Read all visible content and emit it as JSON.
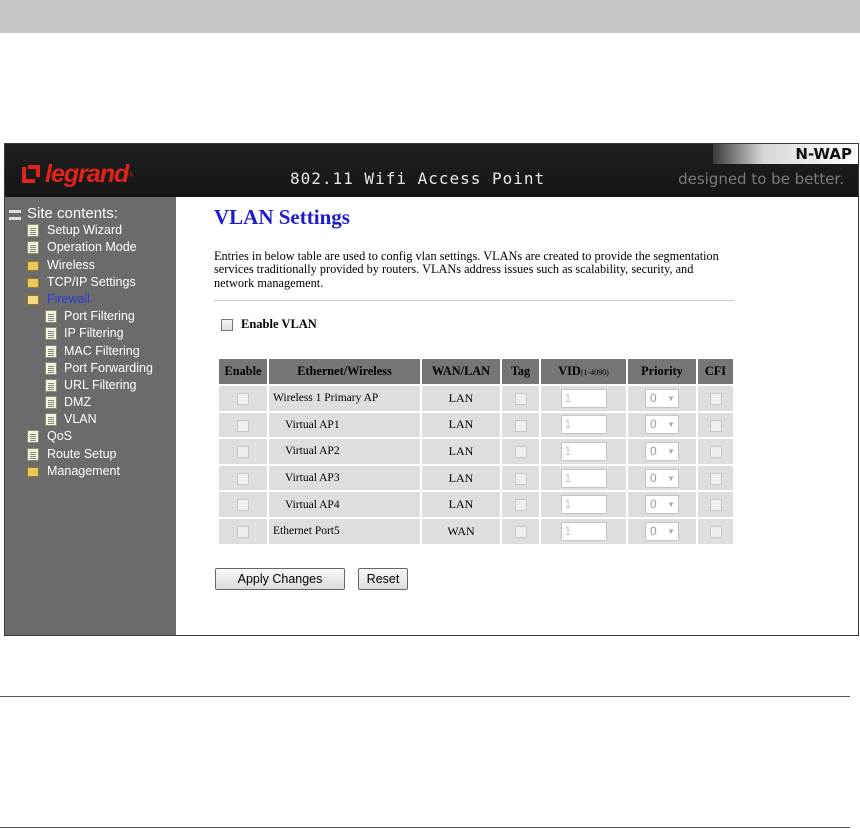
{
  "banner": {
    "brand": "legrand",
    "brand_mark": "®",
    "title": "802.11 Wifi Access Point",
    "product": "N-WAP",
    "tagline": "designed to be better."
  },
  "sidebar": {
    "root_label": "Site contents:",
    "items": [
      {
        "label": "Setup Wizard",
        "icon": "document-icon",
        "level": 0
      },
      {
        "label": "Operation Mode",
        "icon": "document-icon",
        "level": 0
      },
      {
        "label": "Wireless",
        "icon": "folder-icon",
        "level": 0
      },
      {
        "label": "TCP/IP Settings",
        "icon": "folder-icon",
        "level": 0
      },
      {
        "label": "Firewall",
        "icon": "folder-open-icon",
        "level": 0,
        "active": true
      },
      {
        "label": "Port Filtering",
        "icon": "document-icon",
        "level": 1
      },
      {
        "label": "IP Filtering",
        "icon": "document-icon",
        "level": 1
      },
      {
        "label": "MAC Filtering",
        "icon": "document-icon",
        "level": 1
      },
      {
        "label": "Port Forwarding",
        "icon": "document-icon",
        "level": 1
      },
      {
        "label": "URL Filtering",
        "icon": "document-icon",
        "level": 1
      },
      {
        "label": "DMZ",
        "icon": "document-icon",
        "level": 1
      },
      {
        "label": "VLAN",
        "icon": "document-icon",
        "level": 1
      },
      {
        "label": "QoS",
        "icon": "document-icon",
        "level": 0
      },
      {
        "label": "Route Setup",
        "icon": "document-icon",
        "level": 0
      },
      {
        "label": "Management",
        "icon": "folder-icon",
        "level": 0
      }
    ]
  },
  "main": {
    "title": "VLAN Settings",
    "description": "Entries in below table are used to config vlan settings. VLANs are created to provide the segmentation services traditionally provided by routers. VLANs address issues such as scalability, security, and network management.",
    "enable_vlan_label": "Enable VLAN",
    "table": {
      "headers": {
        "enable": "Enable",
        "ethernet_wireless": "Ethernet/Wireless",
        "wan_lan": "WAN/LAN",
        "tag": "Tag",
        "vid": "VID",
        "vid_range": "(1-4090)",
        "priority": "Priority",
        "cfi": "CFI"
      },
      "rows": [
        {
          "name": "Wireless 1 Primary AP",
          "wanlan": "LAN",
          "vid": "1",
          "priority": "0"
        },
        {
          "name": "Virtual AP1",
          "wanlan": "LAN",
          "vid": "1",
          "priority": "0"
        },
        {
          "name": "Virtual AP2",
          "wanlan": "LAN",
          "vid": "1",
          "priority": "0"
        },
        {
          "name": "Virtual AP3",
          "wanlan": "LAN",
          "vid": "1",
          "priority": "0"
        },
        {
          "name": "Virtual AP4",
          "wanlan": "LAN",
          "vid": "1",
          "priority": "0"
        },
        {
          "name": "Ethernet Port5",
          "wanlan": "WAN",
          "vid": "1",
          "priority": "0"
        }
      ]
    },
    "buttons": {
      "apply": "Apply Changes",
      "reset": "Reset"
    }
  },
  "colors": {
    "banner_bg": "#1a1a1a",
    "sidebar_bg": "#6b6b6b",
    "title_blue": "#1c1ccc",
    "brand_red": "#e2231a",
    "header_cell": "#767676",
    "data_cell": "#dedede"
  }
}
